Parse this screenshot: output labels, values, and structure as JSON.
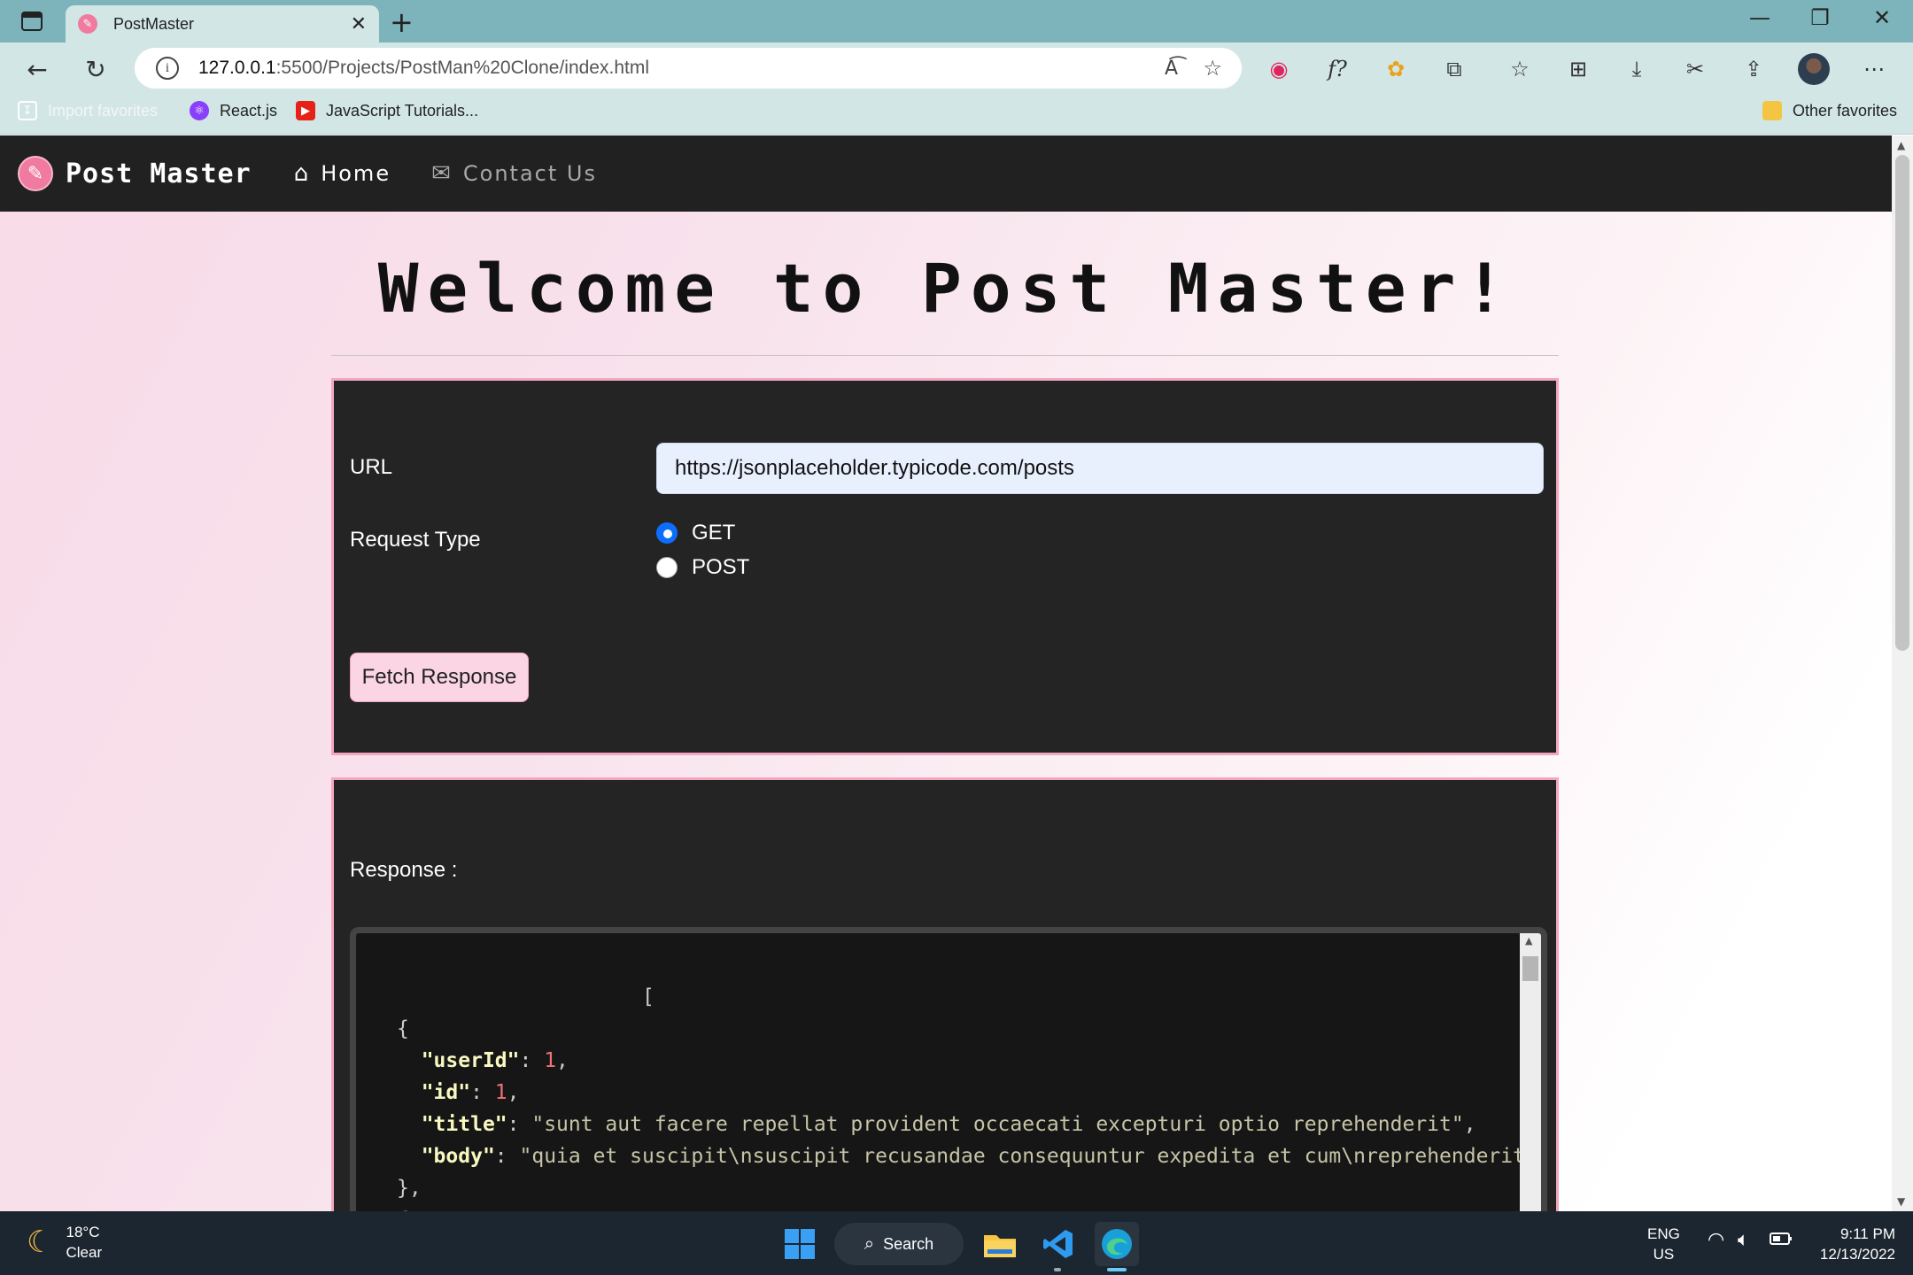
{
  "browser": {
    "tab_title": "PostMaster",
    "tab_close": "✕",
    "new_tab": "+",
    "address_prefix": "127.0.0.1",
    "address_rest": ":5500/Projects/PostMan%20Clone/index.html",
    "favorites": [
      {
        "label": "Import favorites",
        "icon": "import-icon"
      },
      {
        "label": "React.js",
        "icon": "react-icon"
      },
      {
        "label": "JavaScript Tutorials...",
        "icon": "youtube-icon"
      }
    ],
    "other_favorites": "Other favorites",
    "window_controls": [
      "—",
      "❐",
      "✕"
    ]
  },
  "app": {
    "brand": "Post Master",
    "nav": [
      {
        "label": "Home",
        "icon": "home-icon"
      },
      {
        "label": "Contact Us",
        "icon": "envelope-icon"
      }
    ],
    "headline": "Welcome to Post Master!",
    "url_label": "URL",
    "url_value": "https://jsonplaceholder.typicode.com/posts",
    "request_type_label": "Request Type",
    "request_types": [
      {
        "label": "GET",
        "checked": true
      },
      {
        "label": "POST",
        "checked": false
      }
    ],
    "fetch_button": "Fetch Response",
    "response_label": "Response :",
    "response_lines": [
      {
        "indent": "                    ",
        "text": "["
      },
      {
        "indent": "",
        "text": "{"
      },
      {
        "key": "\"userId\"",
        "sep": ": ",
        "num": "1",
        "end": ","
      },
      {
        "key": "\"id\"",
        "sep": ": ",
        "num": "1",
        "end": ","
      },
      {
        "key": "\"title\"",
        "sep": ": ",
        "str": "\"sunt aut facere repellat provident occaecati excepturi optio reprehenderit\"",
        "end": ","
      },
      {
        "key": "\"body\"",
        "sep": ": ",
        "str": "\"quia et suscipit\\nsuscipit recusandae consequuntur expedita et cum\\nreprehenderit mo",
        "end": ""
      },
      {
        "indent": "",
        "text": "},"
      },
      {
        "indent": "",
        "text": "{"
      }
    ]
  },
  "taskbar": {
    "temp": "18°C",
    "condition": "Clear",
    "search": "Search",
    "lang_top": "ENG",
    "lang_bottom": "US",
    "time": "9:11 PM",
    "date": "12/13/2022"
  },
  "colors": {
    "accent_pink": "#f2a7bf",
    "card_bg": "#242424",
    "navbar_bg": "#212121",
    "radio_blue": "#0d6efd"
  }
}
